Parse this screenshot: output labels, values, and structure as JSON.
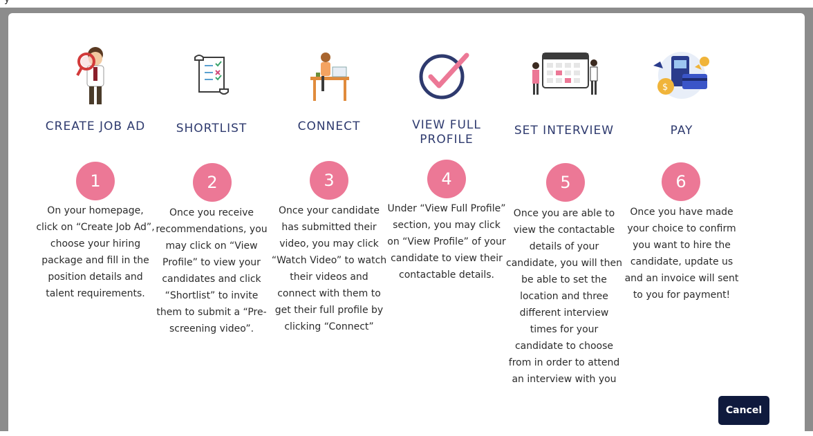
{
  "page": {
    "top_fragment": "y"
  },
  "steps": [
    {
      "number": "1",
      "title": "CREATE JOB AD",
      "icon": "recruiter-magnifier-icon",
      "description": "On your homepage, click on “Create Job Ad”, choose your hiring package and fill in the position details and talent requirements."
    },
    {
      "number": "2",
      "title": "SHORTLIST",
      "icon": "checklist-scroll-icon",
      "description": "Once you receive recommendations, you may click on “View Profile” to view your candidates and click “Shortlist” to invite them to submit a “Pre-screening video”."
    },
    {
      "number": "3",
      "title": "CONNECT",
      "icon": "person-at-desk-icon",
      "description": "Once your candidate has submitted their video, you may click “Watch Video” to watch their videos and connect with them to get their full profile by clicking “Connect”"
    },
    {
      "number": "4",
      "title": "VIEW FULL PROFILE",
      "icon": "checkmark-circle-icon",
      "description": "Under “View Full Profile” section, you may click on “View Profile” of your candidate to view their contactable details."
    },
    {
      "number": "5",
      "title": "SET INTERVIEW",
      "icon": "calendar-schedule-icon",
      "description": "Once you are able to view the contactable details of your candidate, you will then be able to set the location and three different interview times for your candidate to choose from in order to attend an interview with you"
    },
    {
      "number": "6",
      "title": "PAY",
      "icon": "payment-icon",
      "description": "Once you have made your choice to confirm you want to hire the candidate, update us and an invoice will sent to you for payment!"
    }
  ],
  "actions": {
    "cancel_label": "Cancel"
  },
  "colors": {
    "accent_pink": "#ec7896",
    "title_navy": "#2e3a6e",
    "button_navy": "#0f1a3d",
    "backdrop": "#8c8c8c"
  }
}
